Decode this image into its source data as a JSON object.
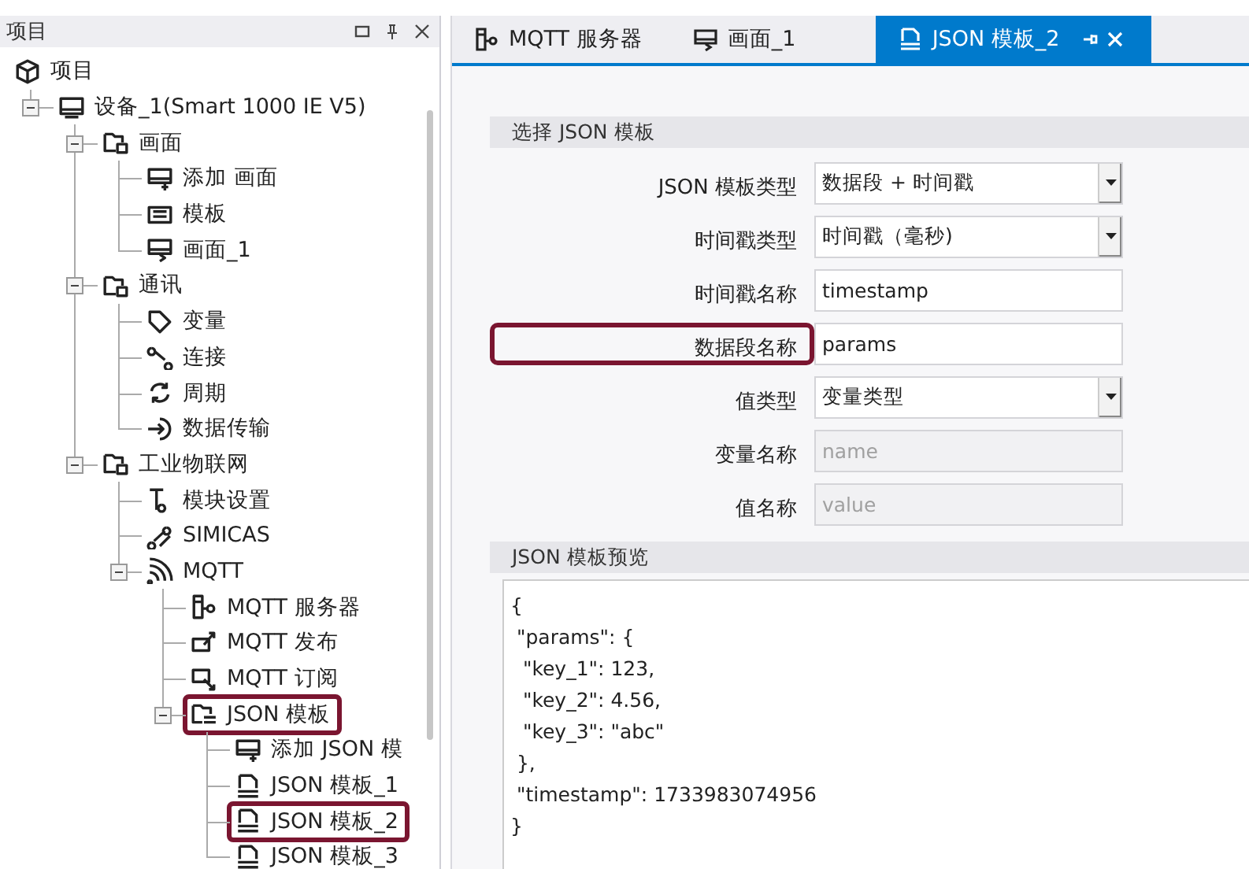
{
  "project_panel": {
    "title": "项目",
    "tree": [
      {
        "label": "项目",
        "kind": "cube",
        "highlighted": false,
        "children": [
          {
            "label": "设备_1(Smart 1000 IE V5)",
            "kind": "device",
            "highlighted": false,
            "expanded": true,
            "children": [
              {
                "label": "画面",
                "kind": "folder",
                "highlighted": false,
                "expanded": true,
                "children": [
                  {
                    "label": "添加 画面",
                    "kind": "screen-add",
                    "highlighted": false
                  },
                  {
                    "label": "模板",
                    "kind": "template",
                    "highlighted": false
                  },
                  {
                    "label": "画面_1",
                    "kind": "screen",
                    "highlighted": false
                  }
                ]
              },
              {
                "label": "通讯",
                "kind": "folder",
                "highlighted": false,
                "expanded": true,
                "children": [
                  {
                    "label": "变量",
                    "kind": "tag",
                    "highlighted": false
                  },
                  {
                    "label": "连接",
                    "kind": "connection",
                    "highlighted": false
                  },
                  {
                    "label": "周期",
                    "kind": "cycle",
                    "highlighted": false
                  },
                  {
                    "label": "数据传输",
                    "kind": "transfer",
                    "highlighted": false
                  }
                ]
              },
              {
                "label": "工业物联网",
                "kind": "folder",
                "highlighted": false,
                "expanded": true,
                "children": [
                  {
                    "label": "模块设置",
                    "kind": "module",
                    "highlighted": false
                  },
                  {
                    "label": "SIMICAS",
                    "kind": "simicas",
                    "highlighted": false
                  },
                  {
                    "label": "MQTT",
                    "kind": "wifi",
                    "highlighted": false,
                    "expanded": true,
                    "children": [
                      {
                        "label": "MQTT 服务器",
                        "kind": "server",
                        "highlighted": false
                      },
                      {
                        "label": "MQTT 发布",
                        "kind": "publish",
                        "highlighted": false
                      },
                      {
                        "label": "MQTT 订阅",
                        "kind": "subscribe",
                        "highlighted": false
                      },
                      {
                        "label": "JSON 模板",
                        "kind": "json-folder",
                        "highlighted": true,
                        "expanded": true,
                        "children": [
                          {
                            "label": "添加 JSON 模",
                            "kind": "screen-add",
                            "highlighted": false
                          },
                          {
                            "label": "JSON 模板_1",
                            "kind": "json",
                            "highlighted": false
                          },
                          {
                            "label": "JSON 模板_2",
                            "kind": "json",
                            "highlighted": true
                          },
                          {
                            "label": "JSON 模板_3",
                            "kind": "json",
                            "highlighted": false
                          }
                        ]
                      }
                    ]
                  }
                ]
              }
            ]
          }
        ]
      }
    ]
  },
  "tabs": [
    {
      "label": "MQTT 服务器",
      "kind": "server",
      "selected": false
    },
    {
      "label": "画面_1",
      "kind": "screen",
      "selected": false
    },
    {
      "label": "JSON 模板_2",
      "kind": "json",
      "selected": true
    }
  ],
  "select_section": {
    "title": "选择 JSON 模板",
    "fields": [
      {
        "label": "JSON 模板类型",
        "value": "数据段 + 时间戳",
        "kind": "dropdown",
        "disabled": false,
        "highlighted": false
      },
      {
        "label": "时间戳类型",
        "value": "时间戳（毫秒)",
        "kind": "dropdown",
        "disabled": false,
        "highlighted": false
      },
      {
        "label": "时间戳名称",
        "value": "timestamp",
        "kind": "text",
        "disabled": false,
        "highlighted": false
      },
      {
        "label": "数据段名称",
        "value": "params",
        "kind": "text",
        "disabled": false,
        "highlighted": true
      },
      {
        "label": "值类型",
        "value": "变量类型",
        "kind": "dropdown",
        "disabled": false,
        "highlighted": false
      },
      {
        "label": "变量名称",
        "placeholder": "name",
        "kind": "text",
        "disabled": true,
        "highlighted": false
      },
      {
        "label": "值名称",
        "placeholder": "value",
        "kind": "text",
        "disabled": true,
        "highlighted": false
      }
    ]
  },
  "preview_section": {
    "title": "JSON 模板预览",
    "lines": [
      "{",
      " \"params\": {",
      "  \"key_1\": 123,",
      "  \"key_2\": 4.56,",
      "  \"key_3\": \"abc\"",
      " },",
      " \"timestamp\": 1733983074956",
      "}"
    ]
  }
}
